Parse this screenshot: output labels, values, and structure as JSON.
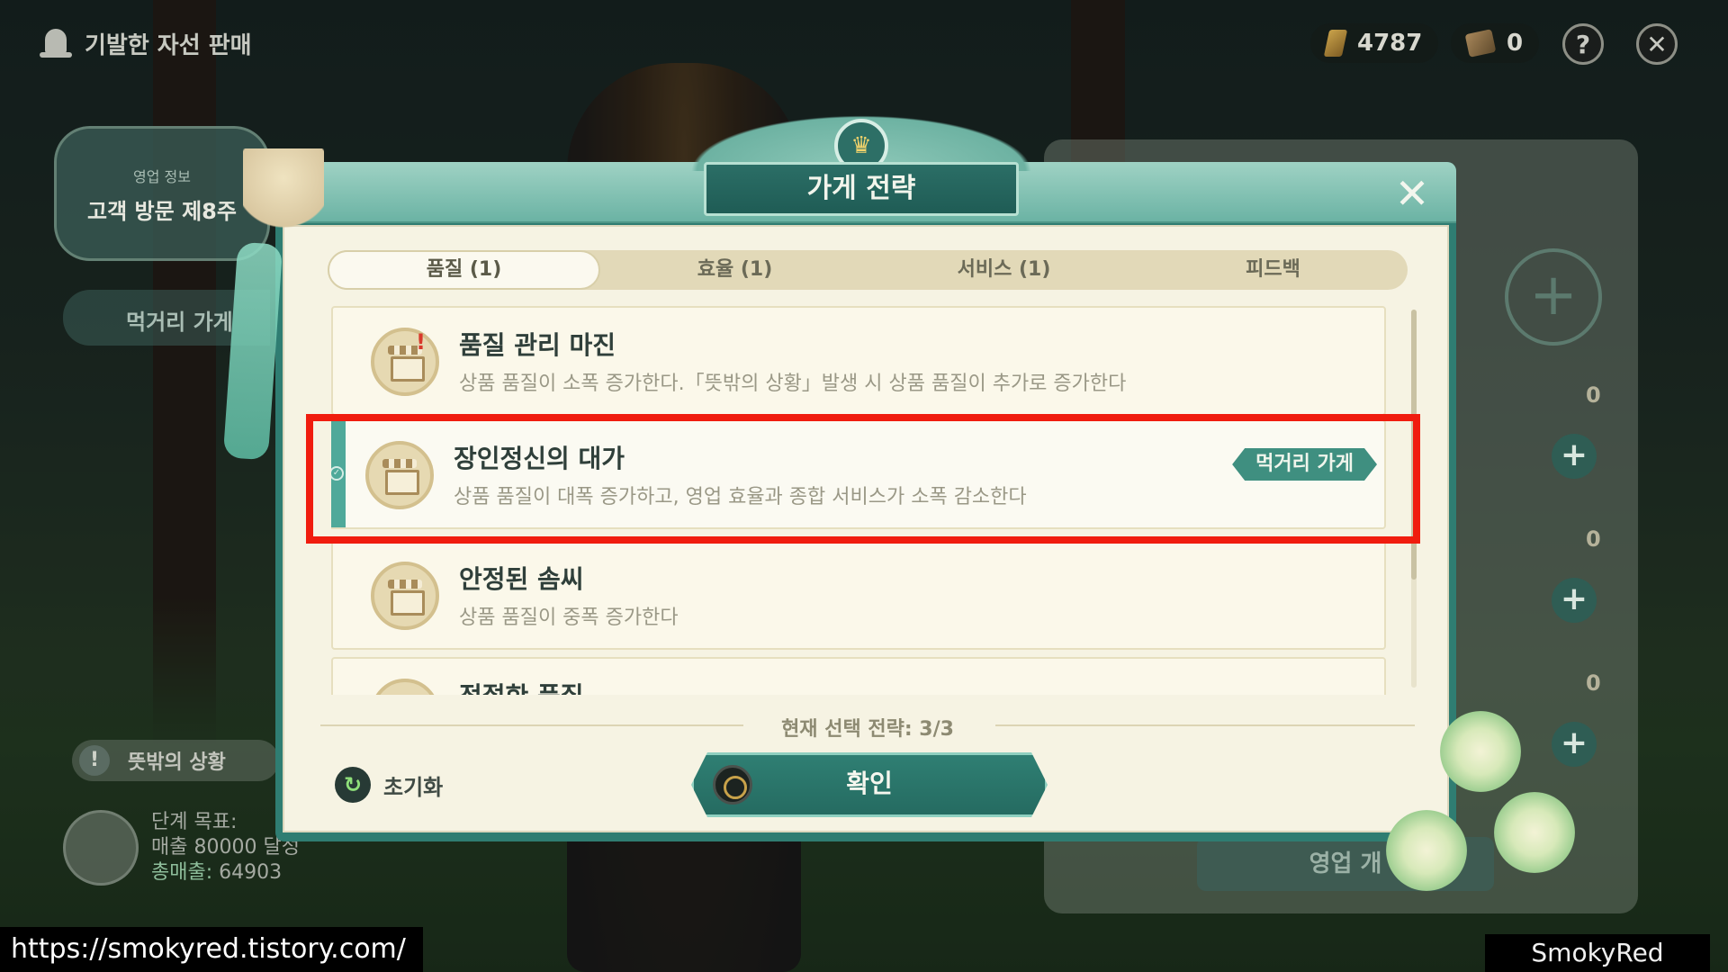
{
  "top_bar": {
    "event_title": "기발한 자선 판매",
    "gems": "4787",
    "tickets": "0",
    "help_label": "?",
    "close_label": "✕"
  },
  "left_panel": {
    "info_label": "영업 정보",
    "info_value": "고객 방문 제8주",
    "shop_label": "먹거리 가게",
    "event_label": "뜻밖의 상황",
    "goal_label": "단계 목표:",
    "goal_value": "매출 80000 달성",
    "total_sales_label": "총매출:",
    "total_sales_value": "64903"
  },
  "right_panel": {
    "slot_counts": [
      "0",
      "0",
      "0"
    ],
    "business_label": "영업 개"
  },
  "modal": {
    "title": "가게 전략",
    "close_label": "✕",
    "tabs": [
      {
        "label": "품질 (1)",
        "active": true
      },
      {
        "label": "효율 (1)",
        "active": false
      },
      {
        "label": "서비스 (1)",
        "active": false
      },
      {
        "label": "피드백",
        "active": false
      }
    ],
    "strategies": [
      {
        "name": "품질 관리 마진",
        "desc": "상품 품질이 소폭 증가한다.「뜻밖의 상황」발생 시 상품 품질이 추가로 증가한다",
        "selected": false,
        "mark": "!"
      },
      {
        "name": "장인정신의 대가",
        "desc": "상품 품질이 대폭 증가하고, 영업 효율과 종합 서비스가 소폭 감소한다",
        "selected": true,
        "tag": "먹거리 가게"
      },
      {
        "name": "안정된 솜씨",
        "desc": "상품 품질이 중폭 증가한다",
        "selected": false
      },
      {
        "name": "적절한 품질",
        "desc": "",
        "selected": false
      }
    ],
    "strategy_status": "현재 선택 전략: 3/3",
    "reset_label": "초기화",
    "confirm_label": "확인"
  },
  "watermark": {
    "url": "https://smokyred.tistory.com/",
    "author": "SmokyRed"
  },
  "colors": {
    "accent_teal": "#2f7d72",
    "highlight_red": "#f01c0e",
    "panel_cream": "#f6f3e3"
  }
}
